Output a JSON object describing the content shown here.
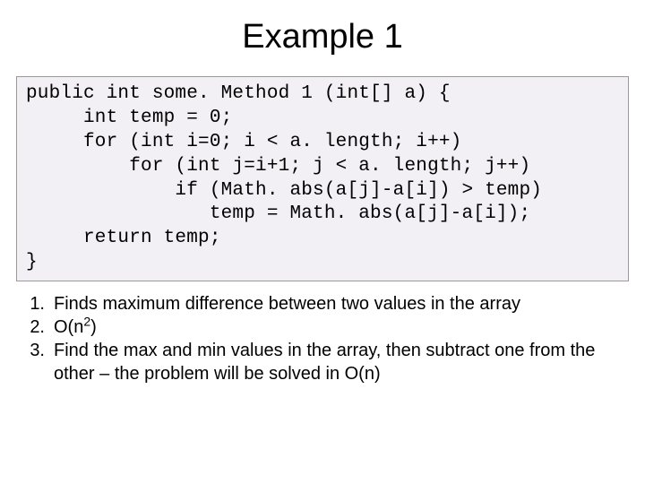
{
  "title": "Example 1",
  "code": {
    "line1": "public int some. Method 1 (int[] a) {",
    "line2": "     int temp = 0;",
    "line3": "     for (int i=0; i < a. length; i++)",
    "line4": "         for (int j=i+1; j < a. length; j++)",
    "line5": "             if (Math. abs(a[j]-a[i]) > temp)",
    "line6": "                temp = Math. abs(a[j]-a[i]);",
    "line7": "     return temp;",
    "line8": "}"
  },
  "notes": {
    "n1_num": "1.",
    "n1_text": "Finds maximum difference between two values in the array",
    "n2_num": "2.",
    "n2_prefix": "O(n",
    "n2_sup": "2",
    "n2_suffix": ")",
    "n3_num": "3.",
    "n3_text": "Find the max and min values in the array, then subtract one from the other – the problem will be solved in O(n)"
  }
}
